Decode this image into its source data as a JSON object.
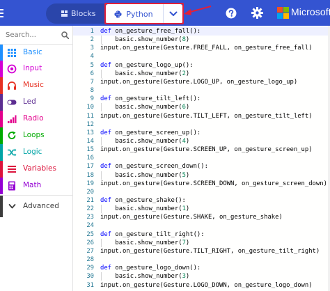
{
  "topbar": {
    "blocks_label": "Blocks",
    "python_label": "Python",
    "brand": "Microsoft",
    "icons": [
      "blocks-icon",
      "python-icon",
      "chevron-down-icon",
      "help-icon",
      "gear-icon",
      "microsoft-logo"
    ],
    "accent_color": "#3454d1",
    "highlight_color": "#e0203a"
  },
  "toolbox": {
    "search_placeholder": "Search...",
    "categories": [
      {
        "label": "Basic",
        "color": "#1e90ff",
        "icon": "grid-icon"
      },
      {
        "label": "Input",
        "color": "#d400d4",
        "icon": "target-icon"
      },
      {
        "label": "Music",
        "color": "#e63022",
        "icon": "headphones-icon"
      },
      {
        "label": "Led",
        "color": "#5c2d91",
        "icon": "toggle-icon"
      },
      {
        "label": "Radio",
        "color": "#e3008c",
        "icon": "signal-icon"
      },
      {
        "label": "Loops",
        "color": "#00aa00",
        "icon": "loop-icon"
      },
      {
        "label": "Logic",
        "color": "#00a4a6",
        "icon": "shuffle-icon"
      },
      {
        "label": "Variables",
        "color": "#dc143c",
        "icon": "list-icon"
      },
      {
        "label": "Math",
        "color": "#9400d3",
        "icon": "calculator-icon"
      }
    ],
    "advanced_label": "Advanced"
  },
  "editor": {
    "lines": [
      {
        "n": "1",
        "kw": "def",
        "rest": " on_gesture_free_fall():"
      },
      {
        "n": "2",
        "indent": true,
        "pre": "basic.show_number(",
        "num": "8",
        "post": ")"
      },
      {
        "n": "3",
        "text": "input.on_gesture(Gesture.FREE_FALL, on_gesture_free_fall)"
      },
      {
        "n": "4",
        "text": ""
      },
      {
        "n": "5",
        "kw": "def",
        "rest": " on_gesture_logo_up():"
      },
      {
        "n": "6",
        "indent": true,
        "pre": "basic.show_number(",
        "num": "2",
        "post": ")"
      },
      {
        "n": "7",
        "text": "input.on_gesture(Gesture.LOGO_UP, on_gesture_logo_up)"
      },
      {
        "n": "8",
        "text": ""
      },
      {
        "n": "9",
        "kw": "def",
        "rest": " on_gesture_tilt_left():"
      },
      {
        "n": "10",
        "indent": true,
        "pre": "basic.show_number(",
        "num": "6",
        "post": ")"
      },
      {
        "n": "11",
        "text": "input.on_gesture(Gesture.TILT_LEFT, on_gesture_tilt_left)"
      },
      {
        "n": "12",
        "text": ""
      },
      {
        "n": "13",
        "kw": "def",
        "rest": " on_gesture_screen_up():"
      },
      {
        "n": "14",
        "indent": true,
        "pre": "basic.show_number(",
        "num": "4",
        "post": ")"
      },
      {
        "n": "15",
        "text": "input.on_gesture(Gesture.SCREEN_UP, on_gesture_screen_up)"
      },
      {
        "n": "16",
        "text": ""
      },
      {
        "n": "17",
        "kw": "def",
        "rest": " on_gesture_screen_down():"
      },
      {
        "n": "18",
        "indent": true,
        "pre": "basic.show_number(",
        "num": "5",
        "post": ")"
      },
      {
        "n": "19",
        "text": "input.on_gesture(Gesture.SCREEN_DOWN, on_gesture_screen_down)"
      },
      {
        "n": "20",
        "text": ""
      },
      {
        "n": "21",
        "kw": "def",
        "rest": " on_gesture_shake():"
      },
      {
        "n": "22",
        "indent": true,
        "pre": "basic.show_number(",
        "num": "1",
        "post": ")"
      },
      {
        "n": "23",
        "text": "input.on_gesture(Gesture.SHAKE, on_gesture_shake)"
      },
      {
        "n": "24",
        "text": ""
      },
      {
        "n": "25",
        "kw": "def",
        "rest": " on_gesture_tilt_right():"
      },
      {
        "n": "26",
        "indent": true,
        "pre": "basic.show_number(",
        "num": "7",
        "post": ")"
      },
      {
        "n": "27",
        "text": "input.on_gesture(Gesture.TILT_RIGHT, on_gesture_tilt_right)"
      },
      {
        "n": "28",
        "text": ""
      },
      {
        "n": "29",
        "kw": "def",
        "rest": " on_gesture_logo_down():"
      },
      {
        "n": "30",
        "indent": true,
        "pre": "basic.show_number(",
        "num": "3",
        "post": ")"
      },
      {
        "n": "31",
        "text": "input.on_gesture(Gesture.LOGO_DOWN, on_gesture_logo_down)"
      }
    ]
  }
}
